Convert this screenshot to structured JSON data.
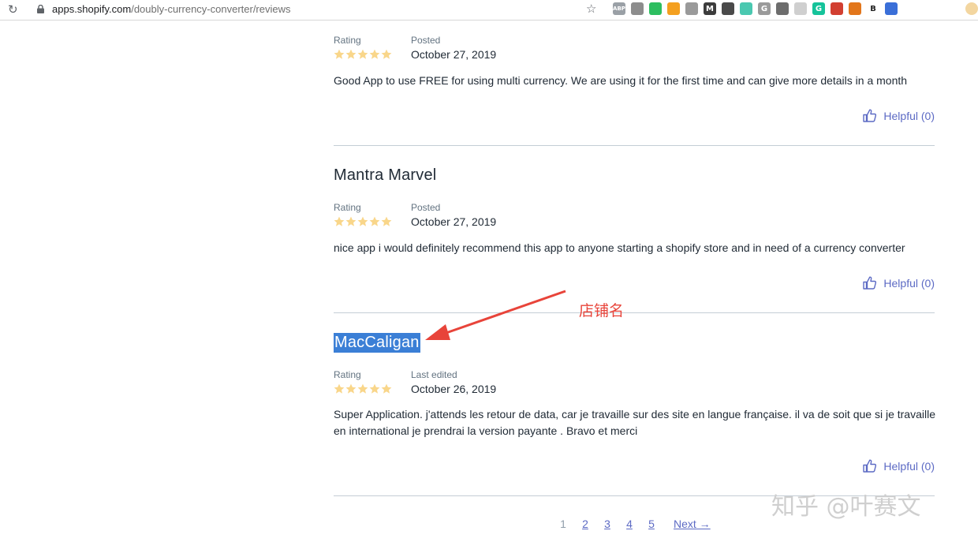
{
  "browser": {
    "url_host": "apps.shopify.com",
    "url_path": "/doubly-currency-converter/reviews",
    "extensions": [
      {
        "label": "ABP",
        "color": "#9aa0a6"
      },
      {
        "label": "",
        "color": "#8d8d8d"
      },
      {
        "label": "",
        "color": "#2dbe60"
      },
      {
        "label": "",
        "color": "#f4a020"
      },
      {
        "label": "",
        "color": "#9a9a9a"
      },
      {
        "label": "M",
        "color": "#3c3c3c"
      },
      {
        "label": "",
        "color": "#4a4a4a"
      },
      {
        "label": "",
        "color": "#4ac8b0"
      },
      {
        "label": "G",
        "color": "#9a9a9a"
      },
      {
        "label": "",
        "color": "#6d6d6d"
      },
      {
        "label": "",
        "color": "#cfcfcf"
      },
      {
        "label": "G",
        "color": "#15c39a"
      },
      {
        "label": "",
        "color": "#d23f31"
      },
      {
        "label": "",
        "color": "#e2761b"
      },
      {
        "label": "B",
        "color": "#ffffff"
      },
      {
        "label": "",
        "color": "#3a6fd8"
      }
    ]
  },
  "labels": {
    "rating": "Rating",
    "posted": "Posted",
    "last_edited": "Last edited",
    "helpful": "Helpful (0)"
  },
  "reviews": [
    {
      "name": "",
      "date_label": "Posted",
      "date": "October 27, 2019",
      "rating": 5,
      "body": "Good App to use FREE for using multi currency. We are using it for the first time and can give more details in a month",
      "helpful": "Helpful (0)"
    },
    {
      "name": "Mantra Marvel",
      "date_label": "Posted",
      "date": "October 27, 2019",
      "rating": 5,
      "body": "nice app i would definitely recommend this app to anyone starting a shopify store and in need of a currency converter",
      "helpful": "Helpful (0)"
    },
    {
      "name": "MacCaligan",
      "date_label": "Last edited",
      "date": "October 26, 2019",
      "rating": 5,
      "body": "Super Application. j'attends les retour de data, car je travaille sur des site en langue française. il va de soit que si je travaille en international je prendrai la version payante . Bravo et merci",
      "helpful": "Helpful (0)"
    }
  ],
  "annotation": {
    "text": "店铺名",
    "color": "#e8443a"
  },
  "pagination": {
    "pages": [
      "1",
      "2",
      "3",
      "4",
      "5"
    ],
    "current": "1",
    "next": "Next →"
  },
  "watermark": "知乎 @叶赛文",
  "colors": {
    "link": "#5c6ac4",
    "star": "#f9d68a",
    "selection": "#3b7fd6"
  }
}
